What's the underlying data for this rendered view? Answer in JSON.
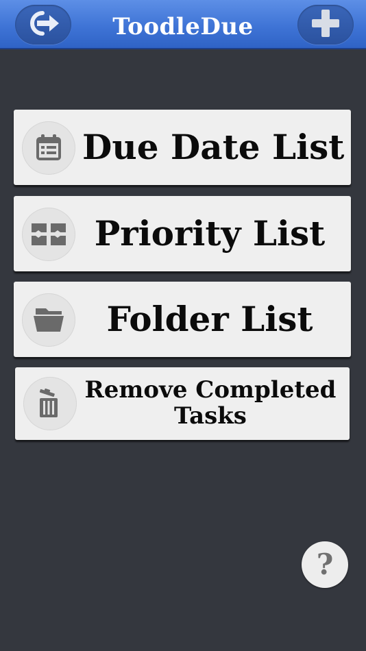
{
  "app": {
    "title": "ToodleDue"
  },
  "header": {
    "left_icon": "logout-icon",
    "right_icon": "add-icon"
  },
  "menu": [
    {
      "label": "Due Date List",
      "icon": "calendar-icon"
    },
    {
      "label": "Priority List",
      "icon": "priority-grid-icon"
    },
    {
      "label": "Folder List",
      "icon": "folder-icon"
    },
    {
      "label_line1": "Remove Completed",
      "label_line2": "Tasks",
      "icon": "trash-icon"
    }
  ],
  "help": {
    "glyph": "?"
  },
  "colors": {
    "header": "#3f74d6",
    "background": "#34373e",
    "button": "#efefef",
    "icon": "#6a6a6a"
  }
}
